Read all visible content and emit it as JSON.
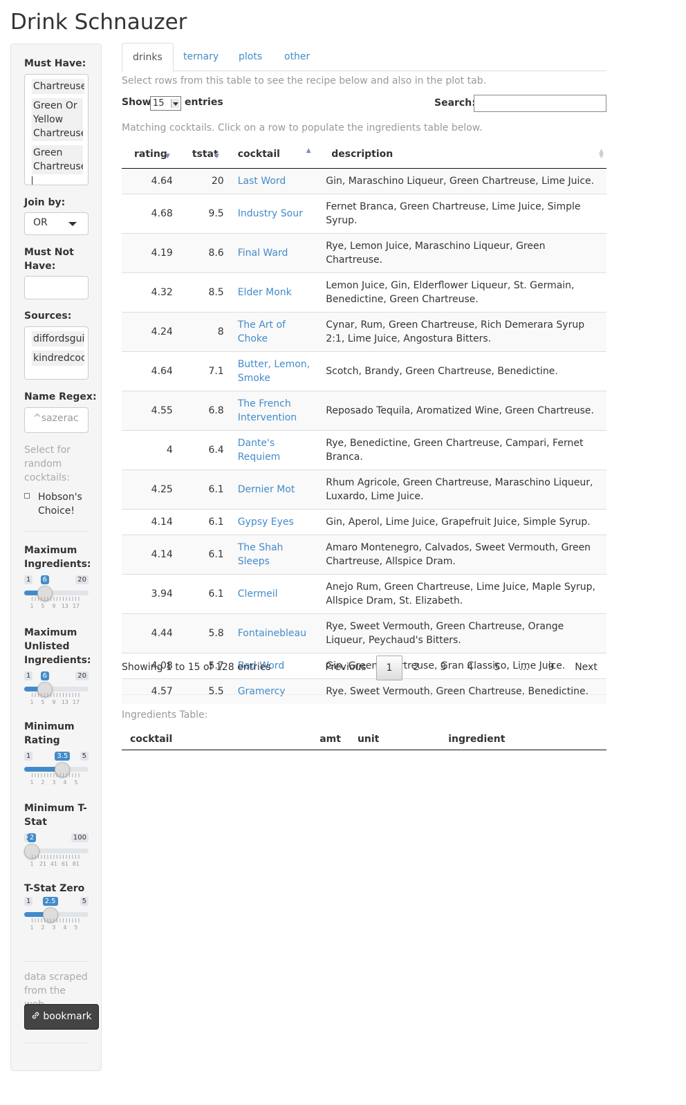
{
  "app": {
    "title": "Drink Schnauzer"
  },
  "sidebar": {
    "must_have_label": "Must Have:",
    "must_have_items": [
      "Chartreuse",
      "Green Or Yellow Chartreuse",
      "Green Chartreuse"
    ],
    "join_by_label": "Join by:",
    "join_by_value": "OR",
    "must_not_have_label": "Must Not Have:",
    "sources_label": "Sources:",
    "sources_items": [
      "diffordsguide",
      "kindredcocktails"
    ],
    "name_regex_label": "Name Regex:",
    "name_regex_placeholder": "^sazerac",
    "random_label": "Select for random cocktails:",
    "hobsons_choice_label": "Hobson's Choice!",
    "sliders": [
      {
        "label": "Maximum Ingredients:",
        "min": "1",
        "max": "20",
        "value": "6",
        "fraction": 0.263,
        "grid": [
          "1",
          "5",
          "9",
          "13",
          "17"
        ]
      },
      {
        "label": "Maximum Unlisted Ingredients:",
        "min": "1",
        "max": "20",
        "value": "6",
        "fraction": 0.263,
        "grid": [
          "1",
          "5",
          "9",
          "13",
          "17"
        ]
      },
      {
        "label": "Minimum Rating",
        "min": "1",
        "max": "5",
        "value": "3.5",
        "fraction": 0.625,
        "grid": [
          "1",
          "2",
          "3",
          "4",
          "5"
        ]
      },
      {
        "label": "Minimum T-Stat",
        "min": "2",
        "max": "100",
        "value": "2",
        "fraction": 0.0,
        "grid": [
          "1",
          "21",
          "41",
          "61",
          "81"
        ]
      },
      {
        "label": "T-Stat Zero",
        "min": "1",
        "max": "5",
        "value": "2.5",
        "fraction": 0.375,
        "grid": [
          "1",
          "2",
          "3",
          "4",
          "5"
        ]
      }
    ],
    "footer_text": "data scraped from the web",
    "bookmark_label": "bookmark"
  },
  "tabs": [
    "drinks",
    "ternary",
    "plots",
    "other"
  ],
  "main": {
    "caption_top": "Select rows from this table to see the recipe below and also in the plot tab.",
    "show_label": "Show",
    "show_value": "15",
    "entries_label": "entries",
    "search_label": "Search:",
    "caption_table": "Matching cocktails. Click on a row to populate the ingredients table below.",
    "columns": [
      "rating",
      "tstat",
      "cocktail",
      "description"
    ],
    "rows": [
      {
        "rating": "4.64",
        "tstat": "20",
        "cocktail": "Last Word",
        "description": "Gin, Maraschino Liqueur, Green Chartreuse, Lime Juice."
      },
      {
        "rating": "4.68",
        "tstat": "9.5",
        "cocktail": "Industry Sour",
        "description": "Fernet Branca, Green Chartreuse, Lime Juice, Simple Syrup."
      },
      {
        "rating": "4.19",
        "tstat": "8.6",
        "cocktail": "Final Ward",
        "description": "Rye, Lemon Juice, Maraschino Liqueur, Green Chartreuse."
      },
      {
        "rating": "4.32",
        "tstat": "8.5",
        "cocktail": "Elder Monk",
        "description": "Lemon Juice, Gin, Elderflower Liqueur, St. Germain, Benedictine, Green Chartreuse."
      },
      {
        "rating": "4.24",
        "tstat": "8",
        "cocktail": "The Art of Choke",
        "description": "Cynar, Rum, Green Chartreuse, Rich Demerara Syrup 2:1, Lime Juice, Angostura Bitters."
      },
      {
        "rating": "4.64",
        "tstat": "7.1",
        "cocktail": "Butter, Lemon, Smoke",
        "description": "Scotch, Brandy, Green Chartreuse, Benedictine."
      },
      {
        "rating": "4.55",
        "tstat": "6.8",
        "cocktail": "The French Intervention",
        "description": "Reposado Tequila, Aromatized Wine, Green Chartreuse."
      },
      {
        "rating": "4",
        "tstat": "6.4",
        "cocktail": "Dante's Requiem",
        "description": "Rye, Benedictine, Green Chartreuse, Campari, Fernet Branca."
      },
      {
        "rating": "4.25",
        "tstat": "6.1",
        "cocktail": "Dernier Mot",
        "description": "Rhum Agricole, Green Chartreuse, Maraschino Liqueur, Luxardo, Lime Juice."
      },
      {
        "rating": "4.14",
        "tstat": "6.1",
        "cocktail": "Gypsy Eyes",
        "description": "Gin, Aperol, Lime Juice, Grapefruit Juice, Simple Syrup."
      },
      {
        "rating": "4.14",
        "tstat": "6.1",
        "cocktail": "The Shah Sleeps",
        "description": "Amaro Montenegro, Calvados, Sweet Vermouth, Green Chartreuse, Allspice Dram."
      },
      {
        "rating": "3.94",
        "tstat": "6.1",
        "cocktail": "Clermeil",
        "description": "Anejo Rum, Green Chartreuse, Lime Juice, Maple Syrup, Allspice Dram, St. Elizabeth."
      },
      {
        "rating": "4.44",
        "tstat": "5.8",
        "cocktail": "Fontainebleau",
        "description": "Rye, Sweet Vermouth, Green Chartreuse, Orange Liqueur, Peychaud's Bitters."
      },
      {
        "rating": "4.08",
        "tstat": "5.7",
        "cocktail": "Bad Word",
        "description": "Gin, Green Chartreuse, Gran Classico, Lime Juice."
      },
      {
        "rating": "4.57",
        "tstat": "5.5",
        "cocktail": "Gramercy",
        "description": "Rye, Sweet Vermouth, Green Chartreuse, Benedictine."
      }
    ],
    "info": "Showing 1 to 15 of 128 entries",
    "pagination": {
      "previous": "Previous",
      "pages": [
        "1",
        "2",
        "3",
        "4",
        "5",
        "…",
        "9"
      ],
      "next": "Next",
      "current": "1"
    },
    "ingredients_caption": "Ingredients Table:",
    "ingredient_columns": [
      "cocktail",
      "amt",
      "unit",
      "ingredient"
    ]
  },
  "colors": {
    "link": "#428bca",
    "slider_fill": "#428bca",
    "bookmark_bg": "#444444"
  },
  "icons": {
    "bookmark": "link-icon",
    "dropdown": "caret-down-icon"
  }
}
